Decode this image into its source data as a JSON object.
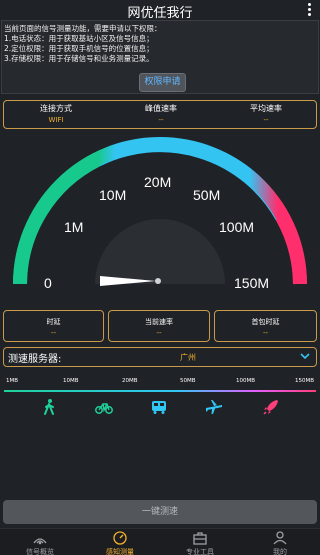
{
  "app": {
    "title": "网优任我行"
  },
  "permission": {
    "lines": [
      "当前页面的信号测量功能，需要申请以下权限：",
      "1.电话状态：用于获取基站小区及信号信息；",
      "2.定位权限：用于获取手机信号的位置信息；",
      "3.存储权限：用于存储信号和业务测量记录。"
    ],
    "button_label": "权限申请"
  },
  "stats": {
    "connection": {
      "label": "连接方式",
      "value": "WIFI"
    },
    "peak": {
      "label": "峰值速率",
      "value": "--"
    },
    "average": {
      "label": "平均速率",
      "value": "--"
    }
  },
  "gauge": {
    "tick_labels": [
      "0",
      "1M",
      "10M",
      "20M",
      "50M",
      "100M",
      "150M"
    ],
    "current_speed": 0,
    "colors": {
      "green": "#18c98e",
      "blue": "#33c4f2",
      "red": "#ff2f6d",
      "track": "#2f3338"
    }
  },
  "metrics": {
    "latency": {
      "label": "时延",
      "value": "--"
    },
    "current_rate": {
      "label": "当前速率",
      "value": "--"
    },
    "first_packet": {
      "label": "首包时延",
      "value": "--"
    }
  },
  "server": {
    "label": "测速服务器:",
    "value": "广州"
  },
  "scale": {
    "labels": [
      "1MB",
      "10MB",
      "20MB",
      "50MB",
      "100MB",
      "150MB"
    ]
  },
  "speed_icons": [
    {
      "name": "walk-icon",
      "color": "#1ed29a"
    },
    {
      "name": "bicycle-icon",
      "color": "#1ed29a"
    },
    {
      "name": "bus-icon",
      "color": "#31c7f5"
    },
    {
      "name": "airplane-icon",
      "color": "#31c7f5"
    },
    {
      "name": "rocket-icon",
      "color": "#ff3f7a"
    }
  ],
  "start_button": {
    "label": "一键测速"
  },
  "tabs": [
    {
      "label": "信号概览",
      "icon": "signal-icon",
      "active": false
    },
    {
      "label": "感知测量",
      "icon": "speedometer-icon",
      "active": true
    },
    {
      "label": "专业工具",
      "icon": "toolbox-icon",
      "active": false
    },
    {
      "label": "我的",
      "icon": "person-icon",
      "active": false
    }
  ],
  "accent": "#f4b12e"
}
